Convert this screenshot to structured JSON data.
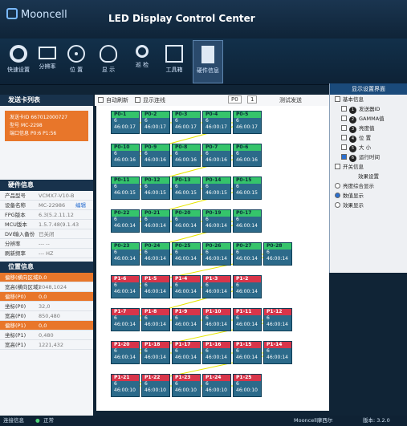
{
  "header": {
    "logo": "Mooncell",
    "title": "LED Display Control Center"
  },
  "toolbar": [
    {
      "label": "快速设置",
      "icon": "gear-icon"
    },
    {
      "label": "分辨率",
      "icon": "monitor-icon"
    },
    {
      "label": "位 置",
      "icon": "target-icon"
    },
    {
      "label": "显 示",
      "icon": "bulb-icon"
    },
    {
      "label": "巡 检",
      "icon": "search-icon"
    },
    {
      "label": "工具箱",
      "icon": "toolbox-icon"
    },
    {
      "label": "硬件信息",
      "icon": "chip-icon"
    }
  ],
  "left": {
    "card_list_title": "发送卡列表",
    "card": {
      "id_label": "发送卡ID",
      "id_value": "667012000727",
      "model_label": "型号",
      "model_value": "MC-2298",
      "port_label": "端口信息",
      "port_value": "P0:6  P1:56"
    },
    "hw_title": "硬件信息",
    "hw": [
      {
        "k": "产品型号",
        "v": "VCMX7-V10-B"
      },
      {
        "k": "设备名称",
        "v": "MC-22986",
        "link": "编辑"
      },
      {
        "k": "FPG版本",
        "v": "6.3(5.2.11.12"
      },
      {
        "k": "MCU版本",
        "v": "1.5.7.48(9.1.43"
      },
      {
        "k": "DVI输入备份",
        "v": "已关闭"
      },
      {
        "k": "分辨率",
        "v": "--- --"
      },
      {
        "k": "刷新频率",
        "v": "--- HZ"
      }
    ],
    "pos_title": "位置信息",
    "pos": [
      {
        "k": "偏移(横向区域)",
        "v": "0,0",
        "hl": true
      },
      {
        "k": "宽高(横向区域)",
        "v": "2048,1024",
        "hl": false
      },
      {
        "k": "偏移(P0)",
        "v": "0,0",
        "hl": true
      },
      {
        "k": "坐标(P0)",
        "v": "32,0",
        "hl": false
      },
      {
        "k": "宽高(P0)",
        "v": "850,480",
        "hl": false
      },
      {
        "k": "偏移(P1)",
        "v": "0,0",
        "hl": true
      },
      {
        "k": "坐标(P1)",
        "v": "0,480",
        "hl": false
      },
      {
        "k": "宽高(P1)",
        "v": "1221,432",
        "hl": false
      }
    ]
  },
  "canvasbar": {
    "auto_refresh": "自动刷新",
    "show_lines": "显示连线",
    "port": "P0",
    "page": "1",
    "test": "测试发送"
  },
  "cabinets": [
    {
      "label": "P0-1",
      "num": "6",
      "time": "46:00:17",
      "c": "green",
      "col": 0,
      "row": 0
    },
    {
      "label": "P0-2",
      "num": "6",
      "time": "46:00:17",
      "c": "green",
      "col": 1,
      "row": 0
    },
    {
      "label": "P0-3",
      "num": "6",
      "time": "46:00:17",
      "c": "green",
      "col": 2,
      "row": 0
    },
    {
      "label": "P0-4",
      "num": "6",
      "time": "46:00:17",
      "c": "green",
      "col": 3,
      "row": 0
    },
    {
      "label": "P0-5",
      "num": "6",
      "time": "46:00:17",
      "c": "green",
      "col": 4,
      "row": 0
    },
    {
      "label": "P0-10",
      "num": "6",
      "time": "46:00:16",
      "c": "green",
      "col": 0,
      "row": 1
    },
    {
      "label": "P0-9",
      "num": "6",
      "time": "46:00:16",
      "c": "green",
      "col": 1,
      "row": 1
    },
    {
      "label": "P0-8",
      "num": "6",
      "time": "46:00:16",
      "c": "green",
      "col": 2,
      "row": 1
    },
    {
      "label": "P0-7",
      "num": "6",
      "time": "46:00:16",
      "c": "green",
      "col": 3,
      "row": 1
    },
    {
      "label": "P0-6",
      "num": "6",
      "time": "46:00:16",
      "c": "green",
      "col": 4,
      "row": 1
    },
    {
      "label": "P0-11",
      "num": "6",
      "time": "46:00:15",
      "c": "green",
      "col": 0,
      "row": 2
    },
    {
      "label": "P0-12",
      "num": "6",
      "time": "46:00:15",
      "c": "green",
      "col": 1,
      "row": 2
    },
    {
      "label": "P0-13",
      "num": "6",
      "time": "46:00:15",
      "c": "green",
      "col": 2,
      "row": 2
    },
    {
      "label": "P0-14",
      "num": "6",
      "time": "46:00:15",
      "c": "green",
      "col": 3,
      "row": 2
    },
    {
      "label": "P0-15",
      "num": "6",
      "time": "46:00:15",
      "c": "green",
      "col": 4,
      "row": 2
    },
    {
      "label": "P0-22",
      "num": "6",
      "time": "46:00:14",
      "c": "green",
      "col": 0,
      "row": 3
    },
    {
      "label": "P0-21",
      "num": "6",
      "time": "46:00:14",
      "c": "green",
      "col": 1,
      "row": 3
    },
    {
      "label": "P0-20",
      "num": "6",
      "time": "46:00:14",
      "c": "green",
      "col": 2,
      "row": 3
    },
    {
      "label": "P0-19",
      "num": "6",
      "time": "46:00:14",
      "c": "green",
      "col": 3,
      "row": 3
    },
    {
      "label": "P0-17",
      "num": "6",
      "time": "46:00:14",
      "c": "green",
      "col": 4,
      "row": 3
    },
    {
      "label": "P0-23",
      "num": "6",
      "time": "46:00:14",
      "c": "green",
      "col": 0,
      "row": 4
    },
    {
      "label": "P0-24",
      "num": "6",
      "time": "46:00:14",
      "c": "green",
      "col": 1,
      "row": 4
    },
    {
      "label": "P0-25",
      "num": "6",
      "time": "46:00:14",
      "c": "green",
      "col": 2,
      "row": 4
    },
    {
      "label": "P0-26",
      "num": "6",
      "time": "46:00:14",
      "c": "green",
      "col": 3,
      "row": 4
    },
    {
      "label": "P0-27",
      "num": "6",
      "time": "46:00:14",
      "c": "green",
      "col": 4,
      "row": 4
    },
    {
      "label": "P0-28",
      "num": "6",
      "time": "46:00:14",
      "c": "green",
      "col": 5,
      "row": 4
    },
    {
      "label": "P1-6",
      "num": "6",
      "time": "46:00:14",
      "c": "red",
      "col": 0,
      "row": 5
    },
    {
      "label": "P1-5",
      "num": "6",
      "time": "46:00:14",
      "c": "red",
      "col": 1,
      "row": 5
    },
    {
      "label": "P1-4",
      "num": "6",
      "time": "46:00:14",
      "c": "red",
      "col": 2,
      "row": 5
    },
    {
      "label": "P1-3",
      "num": "6",
      "time": "46:00:14",
      "c": "red",
      "col": 3,
      "row": 5
    },
    {
      "label": "P1-2",
      "num": "6",
      "time": "46:00:14",
      "c": "red",
      "col": 4,
      "row": 5
    },
    {
      "label": "P1-7",
      "num": "6",
      "time": "46:00:14",
      "c": "red",
      "col": 0,
      "row": 6
    },
    {
      "label": "P1-8",
      "num": "6",
      "time": "46:00:14",
      "c": "red",
      "col": 1,
      "row": 6
    },
    {
      "label": "P1-9",
      "num": "6",
      "time": "46:00:14",
      "c": "red",
      "col": 2,
      "row": 6
    },
    {
      "label": "P1-10",
      "num": "6",
      "time": "46:00:14",
      "c": "red",
      "col": 3,
      "row": 6
    },
    {
      "label": "P1-11",
      "num": "6",
      "time": "46:00:14",
      "c": "red",
      "col": 4,
      "row": 6
    },
    {
      "label": "P1-12",
      "num": "6",
      "time": "46:00:14",
      "c": "red",
      "col": 5,
      "row": 6
    },
    {
      "label": "P1-20",
      "num": "6",
      "time": "46:00:14",
      "c": "red",
      "col": 0,
      "row": 7
    },
    {
      "label": "P1-18",
      "num": "6",
      "time": "46:00:14",
      "c": "red",
      "col": 1,
      "row": 7
    },
    {
      "label": "P1-17",
      "num": "6",
      "time": "46:00:14",
      "c": "red",
      "col": 2,
      "row": 7
    },
    {
      "label": "P1-16",
      "num": "6",
      "time": "46:00:14",
      "c": "red",
      "col": 3,
      "row": 7
    },
    {
      "label": "P1-15",
      "num": "6",
      "time": "46:00:14",
      "c": "red",
      "col": 4,
      "row": 7
    },
    {
      "label": "P1-14",
      "num": "6",
      "time": "46:00:14",
      "c": "red",
      "col": 5,
      "row": 7
    },
    {
      "label": "P1-21",
      "num": "6",
      "time": "46:00:10",
      "c": "red",
      "col": 0,
      "row": 8
    },
    {
      "label": "P1-22",
      "num": "6",
      "time": "46:00:10",
      "c": "red",
      "col": 1,
      "row": 8
    },
    {
      "label": "P1-23",
      "num": "6",
      "time": "46:00:10",
      "c": "red",
      "col": 2,
      "row": 8
    },
    {
      "label": "P1-24",
      "num": "6",
      "time": "46:00:10",
      "c": "red",
      "col": 3,
      "row": 8
    },
    {
      "label": "P1-25",
      "num": "6",
      "time": "46:00:10",
      "c": "red",
      "col": 4,
      "row": 8
    }
  ],
  "dialog": {
    "title": "显示设置界面",
    "basic": "基本信息",
    "basic_items": [
      {
        "n": "1",
        "label": "发送器ID",
        "checked": false
      },
      {
        "n": "2",
        "label": "GAMMA值",
        "checked": false
      },
      {
        "n": "3",
        "label": "亮度值",
        "checked": false
      },
      {
        "n": "4",
        "label": "位 置",
        "checked": false
      },
      {
        "n": "5",
        "label": "大 小",
        "checked": false
      },
      {
        "n": "6",
        "label": "运行时间",
        "checked": true
      }
    ],
    "switch": "开关信息",
    "effect_title": "效果设置",
    "effects": [
      {
        "label": "亮度综合显示",
        "on": false
      },
      {
        "label": "数值显示",
        "on": true
      },
      {
        "label": "效果显示",
        "on": false
      }
    ]
  },
  "status": {
    "left": "连接信息",
    "state": "正常",
    "version": "版本: 3.2.0"
  },
  "watermark": "Mooncell摩西尔",
  "colors": {
    "green": "#35c46b",
    "red": "#d8354a",
    "accent": "#e8762a"
  }
}
